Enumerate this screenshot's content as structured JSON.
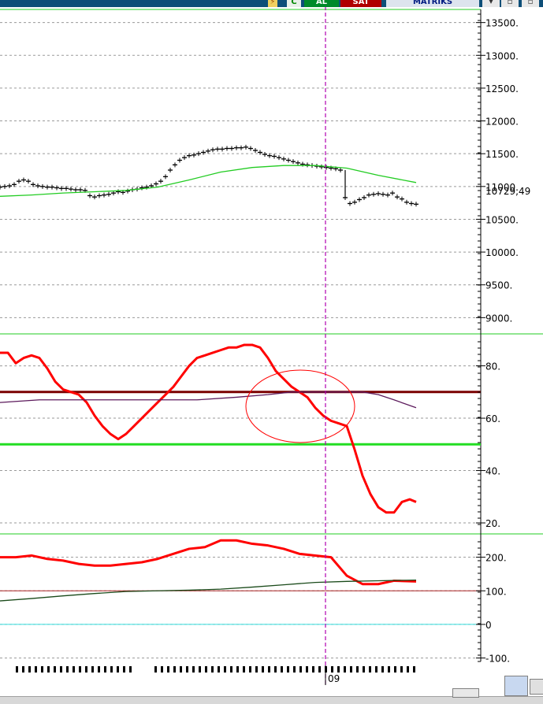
{
  "toolbar": {
    "icon_c": "C",
    "buy_label": "AL",
    "sell_label": "SAT",
    "matrix_label": "MATRİKS"
  },
  "chart_data": [
    {
      "type": "line",
      "title": "",
      "panel": "price",
      "ylim": [
        8800,
        13700
      ],
      "yticks": [
        "13500.",
        "13000.",
        "12500.",
        "12000.",
        "11500.",
        "11000.",
        "10500.",
        "10000.",
        "9500.",
        "9000."
      ],
      "last_value_label": "10729,49",
      "series": [
        {
          "style": "step-bars",
          "color": "#000000",
          "x": [
            0,
            6,
            12,
            18,
            24,
            30,
            36,
            42,
            48,
            54,
            60,
            66,
            72,
            78,
            84,
            90,
            96,
            102,
            108,
            114,
            120,
            126,
            132,
            138,
            144,
            150,
            156,
            162,
            168,
            174,
            180,
            186,
            192,
            198,
            204,
            210,
            216,
            222,
            228,
            234,
            240,
            246,
            252,
            258,
            264,
            270,
            276,
            282,
            288,
            294,
            300,
            306,
            312,
            318,
            324,
            330,
            336,
            342,
            348,
            354,
            360,
            366,
            372,
            378,
            384,
            390,
            396,
            402,
            408,
            414,
            420,
            426,
            432,
            438,
            444,
            450,
            456,
            462,
            468,
            474,
            480,
            486,
            492,
            498,
            504,
            510,
            516,
            522,
            528
          ],
          "values": [
            10990,
            11000,
            11010,
            11030,
            11080,
            11100,
            11080,
            11030,
            11010,
            11000,
            10990,
            10990,
            10980,
            10970,
            10970,
            10960,
            10950,
            10950,
            10940,
            10860,
            10840,
            10860,
            10870,
            10880,
            10900,
            10920,
            10910,
            10930,
            10950,
            10960,
            10980,
            10990,
            11010,
            11040,
            11080,
            11150,
            11250,
            11330,
            11400,
            11440,
            11470,
            11480,
            11500,
            11520,
            11540,
            11560,
            11570,
            11570,
            11580,
            11580,
            11590,
            11590,
            11600,
            11580,
            11550,
            11520,
            11490,
            11470,
            11460,
            11440,
            11420,
            11400,
            11380,
            11360,
            11340,
            11330,
            11320,
            11310,
            11300,
            11290,
            11280,
            11270,
            11250,
            10830,
            10740,
            10760,
            10800,
            10830,
            10870,
            10880,
            10890,
            10880,
            10870,
            10900,
            10840,
            10810,
            10760,
            10740,
            10730
          ]
        },
        {
          "style": "line",
          "color": "#22cc22",
          "x": [
            0,
            40,
            80,
            120,
            160,
            200,
            240,
            280,
            320,
            360,
            400,
            440,
            480,
            528
          ],
          "values": [
            10850,
            10870,
            10900,
            10920,
            10940,
            10990,
            11100,
            11220,
            11290,
            11320,
            11320,
            11280,
            11170,
            11060
          ]
        }
      ]
    },
    {
      "type": "line",
      "title": "",
      "panel": "oscillator",
      "ylim": [
        17,
        91
      ],
      "yticks": [
        "80.",
        "60.",
        "40.",
        "20."
      ],
      "horizontal_lines": [
        {
          "value": 70,
          "color": "#7a0000"
        },
        {
          "value": 50,
          "color": "#22dd22"
        }
      ],
      "series": [
        {
          "color": "#ff0000",
          "x": [
            0,
            10,
            20,
            30,
            40,
            50,
            60,
            70,
            80,
            90,
            100,
            110,
            120,
            130,
            140,
            150,
            160,
            170,
            180,
            190,
            200,
            210,
            220,
            230,
            240,
            250,
            260,
            270,
            280,
            290,
            300,
            310,
            320,
            330,
            340,
            350,
            360,
            370,
            380,
            390,
            400,
            410,
            420,
            430,
            440,
            450,
            460,
            470,
            480,
            490,
            500,
            510,
            520,
            528
          ],
          "values": [
            85,
            85,
            81,
            83,
            84,
            83,
            79,
            74,
            71,
            70,
            69,
            66,
            61,
            57,
            54,
            52,
            54,
            57,
            60,
            63,
            66,
            69,
            72,
            76,
            80,
            83,
            84,
            85,
            86,
            87,
            87,
            88,
            88,
            87,
            83,
            78,
            75,
            72,
            70,
            68,
            64,
            61,
            59,
            58,
            57,
            48,
            38,
            31,
            26,
            24,
            24,
            28,
            29,
            28
          ]
        },
        {
          "color": "#5c1a5c",
          "x": [
            0,
            50,
            100,
            150,
            200,
            250,
            300,
            340,
            370,
            400,
            430,
            460,
            480,
            500,
            528
          ],
          "values": [
            66,
            67,
            67,
            67,
            67,
            67,
            68,
            69,
            70,
            70,
            70,
            70,
            69,
            67,
            64
          ]
        }
      ],
      "annotation": "ellipse"
    },
    {
      "type": "line",
      "title": "",
      "panel": "cci",
      "ylim": [
        -115,
        260
      ],
      "yticks": [
        "200.",
        "100.",
        "0",
        "-100."
      ],
      "horizontal_lines": [
        {
          "value": 100,
          "color": "#aa2222"
        },
        {
          "value": 0,
          "color": "#33dddd"
        }
      ],
      "series": [
        {
          "color": "#ff0000",
          "x": [
            0,
            20,
            40,
            60,
            80,
            100,
            120,
            140,
            160,
            180,
            200,
            220,
            240,
            260,
            280,
            300,
            320,
            340,
            360,
            380,
            400,
            420,
            440,
            460,
            480,
            500,
            528
          ],
          "values": [
            200,
            200,
            205,
            195,
            190,
            180,
            175,
            175,
            180,
            185,
            195,
            210,
            225,
            230,
            250,
            250,
            240,
            235,
            225,
            210,
            205,
            200,
            145,
            120,
            120,
            130,
            128
          ]
        },
        {
          "color": "#1a4a1a",
          "x": [
            0,
            40,
            80,
            120,
            160,
            200,
            240,
            280,
            320,
            360,
            400,
            440,
            480,
            528
          ],
          "values": [
            70,
            77,
            85,
            92,
            98,
            100,
            102,
            105,
            111,
            118,
            125,
            128,
            130,
            132
          ]
        }
      ]
    }
  ],
  "time_axis": {
    "label": "09"
  }
}
